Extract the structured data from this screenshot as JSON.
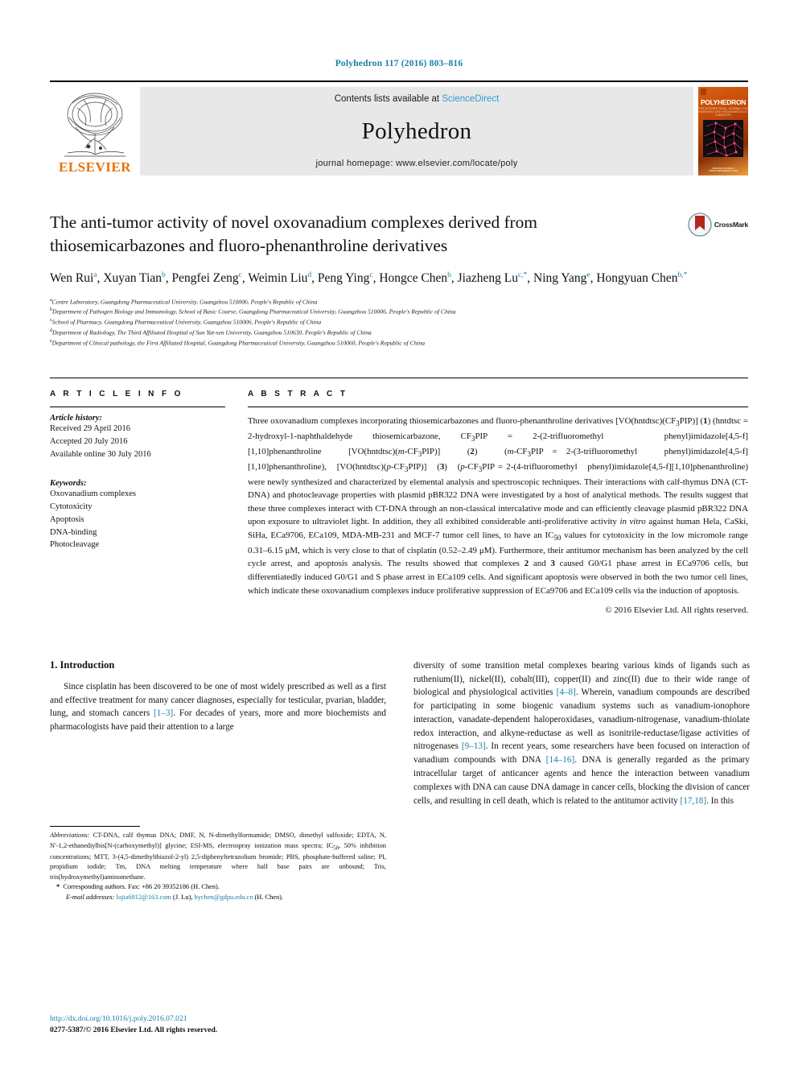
{
  "running_head": "Polyhedron 117 (2016) 803–816",
  "masthead": {
    "publisher": "ELSEVIER",
    "contents_prefix": "Contents lists available at ",
    "contents_link": "ScienceDirect",
    "journal_name": "Polyhedron",
    "homepage": "journal homepage: www.elsevier.com/locate/poly",
    "cover_title": "POLYHEDRON",
    "cover_subtitle": "THE INTERNATIONAL JOURNAL FOR INORGANIC AND ORGANOMETALLIC CHEMISTRY",
    "cover_footer": "AVAILABLE ONLINE AT WWW.SCIENCEDIRECT.COM"
  },
  "article": {
    "title": "The anti-tumor activity of novel oxovanadium complexes derived from thiosemicarbazones and fluoro-phenanthroline derivatives",
    "crossmark_label": "CrossMark",
    "authors_html": "Wen Rui<sup>a</sup>, Xuyan Tian<sup>b</sup>, Pengfei Zeng<sup>c</sup>, Weimin Liu<sup>d</sup>, Peng Ying<sup>c</sup>, Hongce Chen<sup>b</sup>, Jiazheng Lu<sup>c,*</sup>, Ning Yang<sup>e</sup>, Hongyuan Chen<sup>b,*</sup>",
    "affiliations": [
      {
        "mark": "a",
        "text": "Centre Laboratory, Guangdong Pharmaceutical University, Guangzhou 510006, People's Republic of China"
      },
      {
        "mark": "b",
        "text": "Department of Pathogen Biology and Immunology, School of Basic Course, Guangdong Pharmaceutical University, Guangzhou 510006, People's Republic of China"
      },
      {
        "mark": "c",
        "text": "School of Pharmacy, Guangdong Pharmaceutical University, Guangzhou 510006, People's Republic of China"
      },
      {
        "mark": "d",
        "text": "Department of Radiology, The Third Affiliated Hospital of Sun Yat-sen University, Guangzhou 510630, People's Republic of China"
      },
      {
        "mark": "e",
        "text": "Department of Clinical pathology, the First Affiliated Hospital, Guangdong Pharmaceutical University, Guangzhou 510060, People's Republic of China"
      }
    ]
  },
  "article_info": {
    "heading": "A R T I C L E   I N F O",
    "history_label": "Article history:",
    "history": [
      "Received 29 April 2016",
      "Accepted 20 July 2016",
      "Available online 30 July 2016"
    ],
    "keywords_label": "Keywords:",
    "keywords": [
      "Oxovanadium complexes",
      "Cytotoxicity",
      "Apoptosis",
      "DNA-binding",
      "Photocleavage"
    ]
  },
  "abstract": {
    "heading": "A B S T R A C T",
    "text_html": "Three oxovanadium complexes incorporating thiosemicarbazones and fluoro-phenanthroline derivatives [VO(hntdtsc)(CF<sub>3</sub>PIP)] (<b>1</b>) (hntdtsc = 2-hydroxyl-1-naphthaldehyde thiosemicarbazone, CF<sub>3</sub>PIP = 2-(2-trifluoromethyl&nbsp;&nbsp;&nbsp;phenyl)imidazole[4,5-f][1,10]phenanthroline&nbsp;&nbsp;&nbsp;[VO(hntdtsc)(<i>m</i>-CF<sub>3</sub>PIP)]&nbsp;&nbsp;&nbsp;(<b>2</b>)&nbsp;&nbsp;&nbsp;(<i>m</i>-CF<sub>3</sub>PIP = 2-(3-trifluoromethyl&nbsp;&nbsp;&nbsp;phenyl)imidazole[4,5-f][1,10]phenanthroline),&nbsp;&nbsp;&nbsp;[VO(hntdtsc)(<i>p</i>-CF<sub>3</sub>PIP)]&nbsp;&nbsp;&nbsp;(<b>3</b>)&nbsp;&nbsp;&nbsp;(<i>p</i>-CF<sub>3</sub>PIP = 2-(4-trifluoromethyl&nbsp;&nbsp;&nbsp;phenyl)imidazole[4,5-f][1,10]phenanthroline) were newly synthesized and characterized by elemental analysis and spectroscopic techniques. Their interactions with calf-thymus DNA (CT-DNA) and photocleavage properties with plasmid pBR322 DNA were investigated by a host of analytical methods. The results suggest that these three complexes interact with CT-DNA through an non-classical intercalative mode and can efficiently cleavage plasmid pBR322 DNA upon exposure to ultraviolet light. In addition, they all exhibited considerable anti-proliferative activity <i>in vitro</i> against human Hela, CaSki, SiHa, ECa9706, ECa109, MDA-MB-231 and MCF-7 tumor cell lines, to have an IC<sub>50</sub> values for cytotoxicity in the low micromole range 0.31–6.15 μM, which is very close to that of cisplatin (0.52–2.49 μM). Furthermore, their antitumor mechanism has been analyzed by the cell cycle arrest, and apoptosis analysis. The results showed that complexes <b>2</b> and <b>3</b> caused G0/G1 phase arrest in ECa9706 cells, but differentiatedly induced G0/G1 and S phase arrest in ECa109 cells. And significant apoptosis were observed in both the two tumor cell lines, which indicate these oxovanadium complexes induce proliferative suppression of ECa9706 and ECa109 cells via the induction of apoptosis.",
    "copyright": "© 2016 Elsevier Ltd. All rights reserved."
  },
  "body": {
    "section_heading": "1. Introduction",
    "left_paragraph_html": "Since cisplatin has been discovered to be one of most widely prescribed as well as a first and effective treatment for many cancer diagnoses, especially for testicular, pvarian, bladder, lung, and stomach cancers <span class=\"ref\">[1–3]</span>. For decades of years, more and more biochemists and pharmacologists have paid their attention to a large",
    "right_paragraph_html": "diversity of some transition metal complexes bearing various kinds of ligands such as ruthenium(II), nickel(II), cobalt(III), copper(II) and zinc(II) due to their wide range of biological and physiological activities <span class=\"ref\">[4–8]</span>. Wherein, vanadium compounds are described for participating in some biogenic vanadium systems such as vanadium-ionophore interaction, vanadate-dependent haloperoxidases, vanadium-nitrogenase, vanadium-thiolate redox interaction, and alkyne-reductase as well as isonitrile-reductase/ligase activities of nitrogenases <span class=\"ref\">[9–13]</span>. In recent years, some researchers have been focused on interaction of vanadium compounds with DNA <span class=\"ref\">[14–16]</span>. DNA is generally regarded as the primary intracellular target of anticancer agents and hence the interaction between vanadium complexes with DNA can cause DNA damage in cancer cells, blocking the division of cancer cells, and resulting in cell death, which is related to the antitumor activity <span class=\"ref\">[17,18]</span>. In this"
  },
  "footnote": {
    "abbreviations_html": "<i>Abbreviations:</i> CT-DNA, calf thymus DNA; DMF, N, N-dimethylformamide; DMSO, dimethyl sulfoxide; EDTA, N, N′-1,2-ethanediylbis[N-(carboxymethyl)] glycine; ESI-MS, electrospray ionization mass spectra; IC<sub>50</sub>, 50% inhibition concentrations; MTT, 3-(4,5-dimethylthiazol-2-yl) 2,5-diphenyltetrazolium bromide; PBS, phosphate-buffered saline; PI, propidium iodide; Tm, DNA melting temperature where half base pairs are unbound; Tris, tris(hydroxymethyl)aminomethane.",
    "corresponding_html": "<b>*</b>&nbsp; Corresponding authors. Fax: +86 20 39352186 (H. Chen).",
    "email_label": "E-mail addresses:",
    "email_html": "<span class=\"link\">lujia6812@163.com</span> (J. Lu), <span class=\"link\">hychen@gdpu.edu.cn</span> (H. Chen)."
  },
  "bottom": {
    "doi": "http://dx.doi.org/10.1016/j.poly.2016.07.021",
    "issn_copyright": "0277-5387/© 2016 Elsevier Ltd. All rights reserved."
  }
}
